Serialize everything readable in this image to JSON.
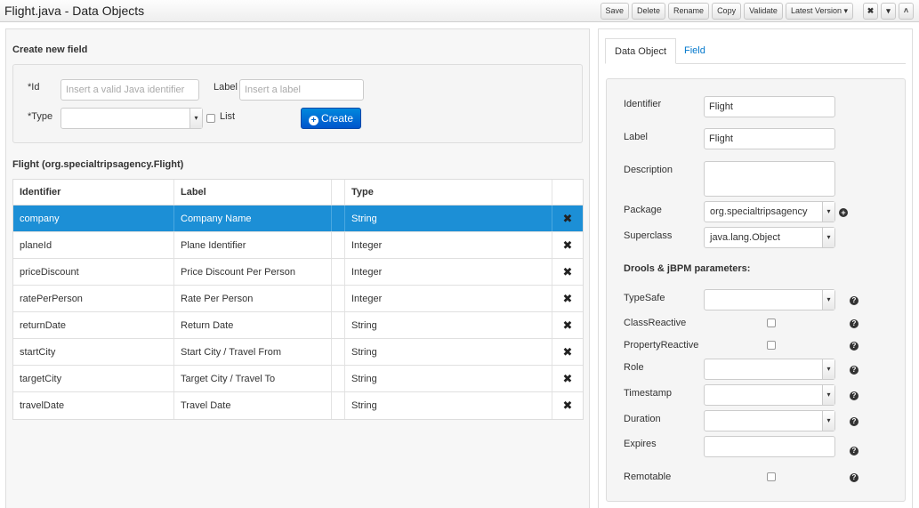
{
  "window": {
    "title": "Flight.java - Data Objects"
  },
  "toolbar": {
    "save": "Save",
    "delete": "Delete",
    "rename": "Rename",
    "copy": "Copy",
    "validate": "Validate",
    "latest_version": "Latest Version ▾",
    "close_glyph": "✖",
    "menu_glyph": "▾",
    "collapse_glyph": "˄"
  },
  "create_field": {
    "title": "Create new field",
    "id_label": "*Id",
    "id_placeholder": "Insert a valid Java identifier",
    "label_label": "Label",
    "label_placeholder": "Insert a label",
    "type_label": "*Type",
    "type_value": "",
    "list_label": "List",
    "create_button": "Create"
  },
  "object": {
    "heading": "Flight (org.specialtripsagency.Flight)"
  },
  "table": {
    "headers": [
      "Identifier",
      "Label",
      "",
      "Type",
      ""
    ],
    "rows": [
      {
        "identifier": "company",
        "label": "Company Name",
        "type": "String"
      },
      {
        "identifier": "planeId",
        "label": "Plane Identifier",
        "type": "Integer"
      },
      {
        "identifier": "priceDiscount",
        "label": "Price Discount Per Person",
        "type": "Integer"
      },
      {
        "identifier": "ratePerPerson",
        "label": "Rate Per Person",
        "type": "Integer"
      },
      {
        "identifier": "returnDate",
        "label": "Return Date",
        "type": "String"
      },
      {
        "identifier": "startCity",
        "label": "Start City / Travel From",
        "type": "String"
      },
      {
        "identifier": "targetCity",
        "label": "Target City / Travel To",
        "type": "String"
      },
      {
        "identifier": "travelDate",
        "label": "Travel Date",
        "type": "String"
      }
    ],
    "delete_glyph": "✖"
  },
  "tabs": {
    "data_object": "Data Object",
    "field": "Field"
  },
  "data_object_form": {
    "identifier_label": "Identifier",
    "identifier_value": "Flight",
    "label_label": "Label",
    "label_value": "Flight",
    "description_label": "Description",
    "description_value": "",
    "package_label": "Package",
    "package_value": "org.specialtripsagency",
    "superclass_label": "Superclass",
    "superclass_value": "java.lang.Object",
    "drools_heading": "Drools & jBPM parameters:",
    "typesafe_label": "TypeSafe",
    "classreactive_label": "ClassReactive",
    "propertyreactive_label": "PropertyReactive",
    "role_label": "Role",
    "timestamp_label": "Timestamp",
    "duration_label": "Duration",
    "expires_label": "Expires",
    "remotable_label": "Remotable",
    "help_glyph": "?",
    "add_glyph": "+"
  },
  "colors": {
    "selected_row": "#1c8fd6",
    "primary_button": "#0066cc",
    "link": "#0077cc"
  }
}
